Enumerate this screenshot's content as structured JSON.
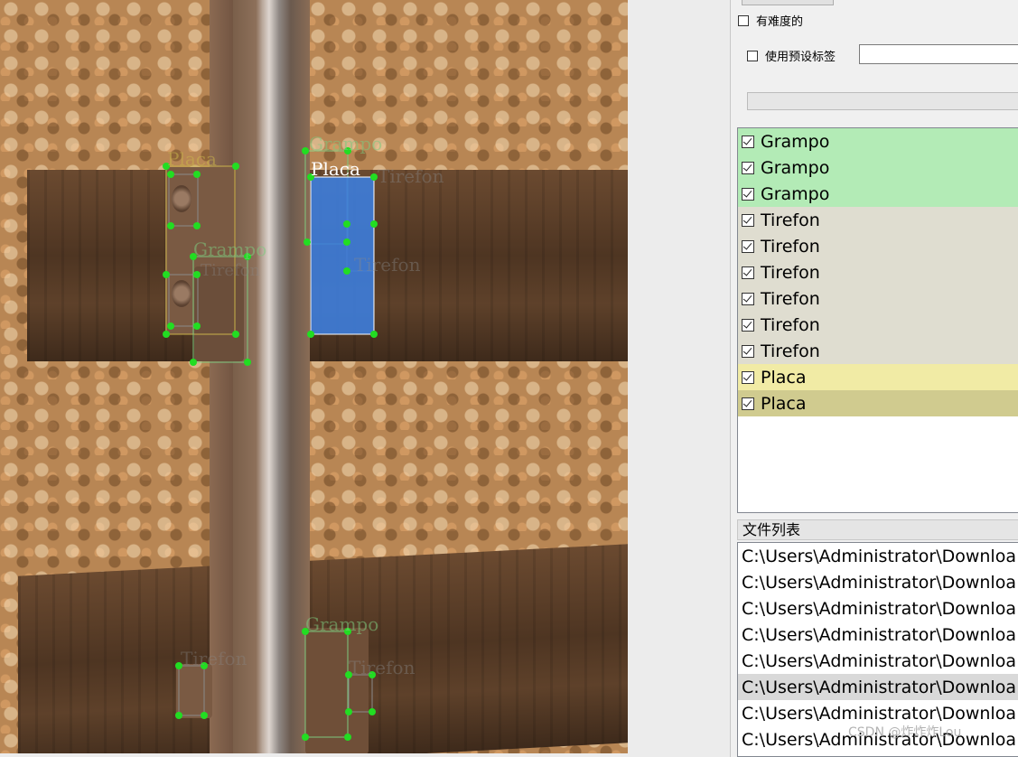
{
  "canvas": {
    "annotations": [
      {
        "label": "Grampo",
        "color": "#7ec87e"
      },
      {
        "label": "Placa",
        "color": "#c9b24a"
      },
      {
        "label": "Tirefon",
        "color": "#8a8a8a"
      }
    ],
    "selected_label": "Placa",
    "selected_color": "#3d7ddb"
  },
  "panel": {
    "difficult_label": "有难度的",
    "difficult_checked": false,
    "use_preset_label": "使用预设标签",
    "use_preset_checked": false,
    "preset_value": "",
    "label_list": [
      {
        "text": "Grampo",
        "checked": true,
        "bg": "#b3ebb6"
      },
      {
        "text": "Grampo",
        "checked": true,
        "bg": "#b3ebb6"
      },
      {
        "text": "Grampo",
        "checked": true,
        "bg": "#b3ebb6"
      },
      {
        "text": "Tirefon",
        "checked": true,
        "bg": "#dfddd0"
      },
      {
        "text": "Tirefon",
        "checked": true,
        "bg": "#dfddd0"
      },
      {
        "text": "Tirefon",
        "checked": true,
        "bg": "#dfddd0"
      },
      {
        "text": "Tirefon",
        "checked": true,
        "bg": "#dfddd0"
      },
      {
        "text": "Tirefon",
        "checked": true,
        "bg": "#dfddd0"
      },
      {
        "text": "Tirefon",
        "checked": true,
        "bg": "#dfddd0"
      },
      {
        "text": "Placa",
        "checked": true,
        "bg": "#f1eba5"
      },
      {
        "text": "Placa",
        "checked": true,
        "bg": "#d0cb8f"
      }
    ],
    "file_list_title": "文件列表",
    "file_list": [
      "C:\\Users\\Administrator\\Downloa",
      "C:\\Users\\Administrator\\Downloa",
      "C:\\Users\\Administrator\\Downloa",
      "C:\\Users\\Administrator\\Downloa",
      "C:\\Users\\Administrator\\Downloa",
      "C:\\Users\\Administrator\\Downloa",
      "C:\\Users\\Administrator\\Downloa",
      "C:\\Users\\Administrator\\Downloa"
    ],
    "file_list_selected_index": 5,
    "watermark": "CSDN @炸炸炸Lou"
  }
}
